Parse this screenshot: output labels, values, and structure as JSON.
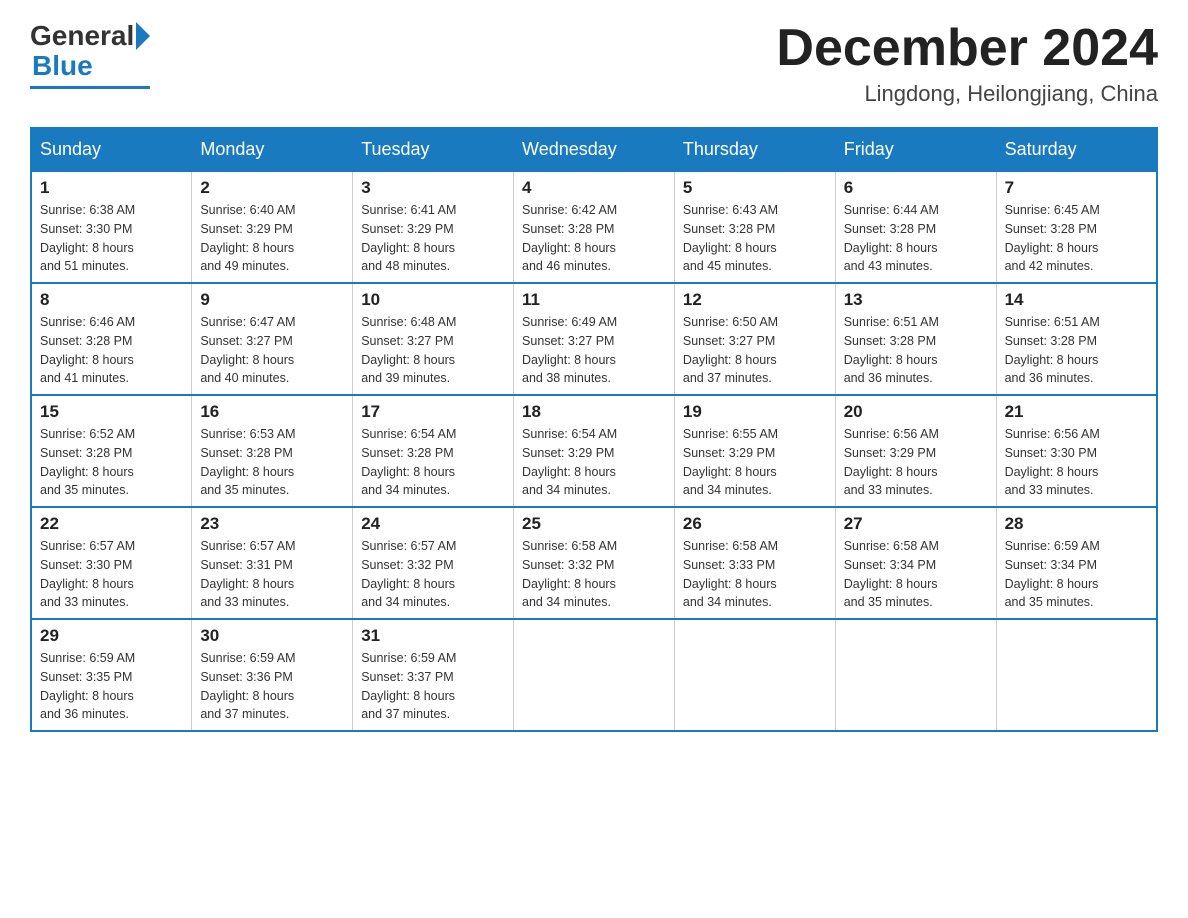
{
  "header": {
    "logo": {
      "part1": "General",
      "part2": "Blue"
    },
    "title": "December 2024",
    "location": "Lingdong, Heilongjiang, China"
  },
  "days_of_week": [
    "Sunday",
    "Monday",
    "Tuesday",
    "Wednesday",
    "Thursday",
    "Friday",
    "Saturday"
  ],
  "weeks": [
    [
      {
        "day": "1",
        "sunrise": "6:38 AM",
        "sunset": "3:30 PM",
        "daylight": "8 hours and 51 minutes."
      },
      {
        "day": "2",
        "sunrise": "6:40 AM",
        "sunset": "3:29 PM",
        "daylight": "8 hours and 49 minutes."
      },
      {
        "day": "3",
        "sunrise": "6:41 AM",
        "sunset": "3:29 PM",
        "daylight": "8 hours and 48 minutes."
      },
      {
        "day": "4",
        "sunrise": "6:42 AM",
        "sunset": "3:28 PM",
        "daylight": "8 hours and 46 minutes."
      },
      {
        "day": "5",
        "sunrise": "6:43 AM",
        "sunset": "3:28 PM",
        "daylight": "8 hours and 45 minutes."
      },
      {
        "day": "6",
        "sunrise": "6:44 AM",
        "sunset": "3:28 PM",
        "daylight": "8 hours and 43 minutes."
      },
      {
        "day": "7",
        "sunrise": "6:45 AM",
        "sunset": "3:28 PM",
        "daylight": "8 hours and 42 minutes."
      }
    ],
    [
      {
        "day": "8",
        "sunrise": "6:46 AM",
        "sunset": "3:28 PM",
        "daylight": "8 hours and 41 minutes."
      },
      {
        "day": "9",
        "sunrise": "6:47 AM",
        "sunset": "3:27 PM",
        "daylight": "8 hours and 40 minutes."
      },
      {
        "day": "10",
        "sunrise": "6:48 AM",
        "sunset": "3:27 PM",
        "daylight": "8 hours and 39 minutes."
      },
      {
        "day": "11",
        "sunrise": "6:49 AM",
        "sunset": "3:27 PM",
        "daylight": "8 hours and 38 minutes."
      },
      {
        "day": "12",
        "sunrise": "6:50 AM",
        "sunset": "3:27 PM",
        "daylight": "8 hours and 37 minutes."
      },
      {
        "day": "13",
        "sunrise": "6:51 AM",
        "sunset": "3:28 PM",
        "daylight": "8 hours and 36 minutes."
      },
      {
        "day": "14",
        "sunrise": "6:51 AM",
        "sunset": "3:28 PM",
        "daylight": "8 hours and 36 minutes."
      }
    ],
    [
      {
        "day": "15",
        "sunrise": "6:52 AM",
        "sunset": "3:28 PM",
        "daylight": "8 hours and 35 minutes."
      },
      {
        "day": "16",
        "sunrise": "6:53 AM",
        "sunset": "3:28 PM",
        "daylight": "8 hours and 35 minutes."
      },
      {
        "day": "17",
        "sunrise": "6:54 AM",
        "sunset": "3:28 PM",
        "daylight": "8 hours and 34 minutes."
      },
      {
        "day": "18",
        "sunrise": "6:54 AM",
        "sunset": "3:29 PM",
        "daylight": "8 hours and 34 minutes."
      },
      {
        "day": "19",
        "sunrise": "6:55 AM",
        "sunset": "3:29 PM",
        "daylight": "8 hours and 34 minutes."
      },
      {
        "day": "20",
        "sunrise": "6:56 AM",
        "sunset": "3:29 PM",
        "daylight": "8 hours and 33 minutes."
      },
      {
        "day": "21",
        "sunrise": "6:56 AM",
        "sunset": "3:30 PM",
        "daylight": "8 hours and 33 minutes."
      }
    ],
    [
      {
        "day": "22",
        "sunrise": "6:57 AM",
        "sunset": "3:30 PM",
        "daylight": "8 hours and 33 minutes."
      },
      {
        "day": "23",
        "sunrise": "6:57 AM",
        "sunset": "3:31 PM",
        "daylight": "8 hours and 33 minutes."
      },
      {
        "day": "24",
        "sunrise": "6:57 AM",
        "sunset": "3:32 PM",
        "daylight": "8 hours and 34 minutes."
      },
      {
        "day": "25",
        "sunrise": "6:58 AM",
        "sunset": "3:32 PM",
        "daylight": "8 hours and 34 minutes."
      },
      {
        "day": "26",
        "sunrise": "6:58 AM",
        "sunset": "3:33 PM",
        "daylight": "8 hours and 34 minutes."
      },
      {
        "day": "27",
        "sunrise": "6:58 AM",
        "sunset": "3:34 PM",
        "daylight": "8 hours and 35 minutes."
      },
      {
        "day": "28",
        "sunrise": "6:59 AM",
        "sunset": "3:34 PM",
        "daylight": "8 hours and 35 minutes."
      }
    ],
    [
      {
        "day": "29",
        "sunrise": "6:59 AM",
        "sunset": "3:35 PM",
        "daylight": "8 hours and 36 minutes."
      },
      {
        "day": "30",
        "sunrise": "6:59 AM",
        "sunset": "3:36 PM",
        "daylight": "8 hours and 37 minutes."
      },
      {
        "day": "31",
        "sunrise": "6:59 AM",
        "sunset": "3:37 PM",
        "daylight": "8 hours and 37 minutes."
      },
      null,
      null,
      null,
      null
    ]
  ],
  "labels": {
    "sunrise": "Sunrise:",
    "sunset": "Sunset:",
    "daylight": "Daylight:"
  }
}
